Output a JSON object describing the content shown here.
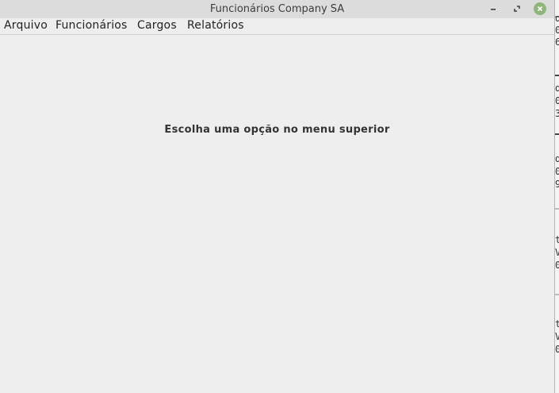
{
  "window": {
    "title": "Funcionários Company SA",
    "controls": {
      "minimize": "minimize-icon",
      "maximize": "maximize-icon",
      "close": "close-icon"
    }
  },
  "menubar": {
    "items": [
      {
        "label": "Arquivo"
      },
      {
        "label": "Funcionários"
      },
      {
        "label": "Cargos"
      },
      {
        "label": "Relatórios"
      }
    ]
  },
  "content": {
    "message": "Escolha uma opção no menu superior"
  },
  "background_window": {
    "fragments": [
      "d",
      "0",
      "6",
      "d",
      "0",
      "3",
      "d",
      "0",
      "9",
      "t_",
      "V",
      "0",
      "t_",
      "V",
      "0"
    ]
  },
  "colors": {
    "titlebar": "#dcdcdc",
    "window_bg": "#eeeeee",
    "close_button": "#8fb57c"
  }
}
